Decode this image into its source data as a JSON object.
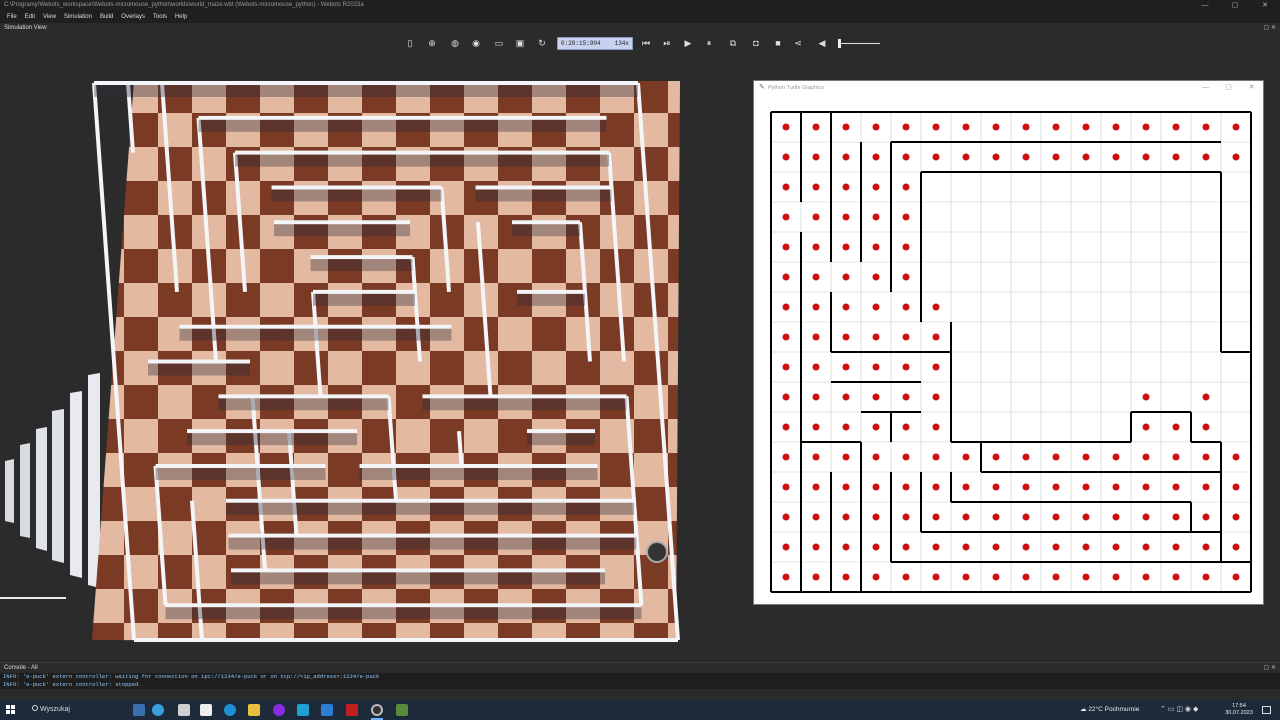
{
  "window": {
    "title": "C:\\Programy\\Webots_workspace\\Webots-micromouse_python\\worlds\\world_maze.wbt (Webots-micromouse_python) - Webots R2023a",
    "ctrl_min": "—",
    "ctrl_max": "▢",
    "ctrl_close": "✕"
  },
  "menu": [
    "File",
    "Edit",
    "View",
    "Simulation",
    "Build",
    "Overlays",
    "Tools",
    "Help"
  ],
  "simulation_view": {
    "label": "Simulation View",
    "ctrls": "▢ ✕"
  },
  "toolbar": {
    "time": "0:28:15:904",
    "speed": "134x",
    "icons": [
      "window-toggle-icon",
      "add-node-icon",
      "globe-icon",
      "eye-icon",
      "open-world-icon",
      "save-world-icon",
      "reload-world-icon",
      "step-back-icon",
      "play-pause-icon",
      "play-icon",
      "pause-icon",
      "fast-forward-icon",
      "screenshot-icon",
      "record-icon",
      "share-icon",
      "volume-icon"
    ]
  },
  "turtle_window": {
    "title": "Python Turtle Graphics",
    "ctrl_min": "—",
    "ctrl_max": "▢",
    "ctrl_close": "✕",
    "grid_rows": 16,
    "grid_cols": 16,
    "dot_color": "#cc1010",
    "empty_regions": [
      {
        "row_from": 2,
        "row_to": 5,
        "col_from": 5,
        "col_to": 15
      },
      {
        "row_from": 6,
        "row_to": 10,
        "col_from": 6,
        "col_to": 15
      },
      {
        "row_from": 9,
        "row_to": 10,
        "col_from": 12,
        "col_to": 15
      }
    ],
    "extra_dots": [
      [
        9,
        12
      ],
      [
        9,
        14
      ],
      [
        10,
        12
      ],
      [
        10,
        13
      ],
      [
        10,
        14
      ]
    ]
  },
  "console": {
    "header": "Console - All",
    "ctrls": "▢ ✕",
    "lines": [
      "INFO: 'e-puck' extern controller: waiting for connection on ipc://1234/e-puck or on tcp://<ip_address>:1234/e-puck",
      "INFO: 'e-puck' extern controller: stopped."
    ]
  },
  "taskbar": {
    "search_placeholder": "Wyszukaj",
    "weather": "22°C  Pochmurnie",
    "time": "17:54",
    "date": "30.07.2023",
    "accent": "#6fb3ff"
  }
}
